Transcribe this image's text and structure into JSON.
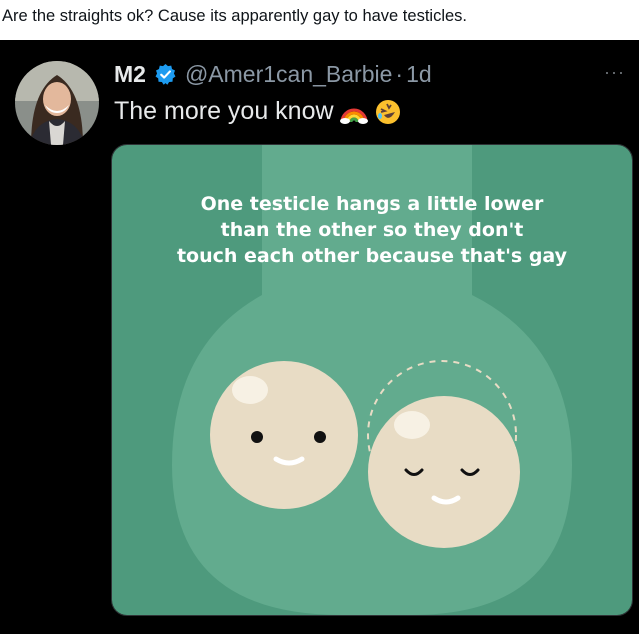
{
  "post_caption": "Are the straights ok? Cause its apparently gay to have testicles.",
  "tweet": {
    "display_name": "M2",
    "handle": "@Amer1can_Barbie",
    "separator": "·",
    "time": "1d",
    "text": "The more you know",
    "emojis": [
      "rainbow-icon",
      "rolling-on-floor-laughing-icon"
    ],
    "more_label": "···"
  },
  "media": {
    "lines": [
      "One testicle hangs a little lower",
      "than the other so they don't",
      "touch each other because that's gay"
    ]
  },
  "colors": {
    "background": "#000000",
    "caption_bar": "#ffffff",
    "verified_badge": "#1d9bf0",
    "meme_bg": "#4e9a7d",
    "meme_shape": "#62ab8e",
    "ball": "#e8dcc5"
  }
}
